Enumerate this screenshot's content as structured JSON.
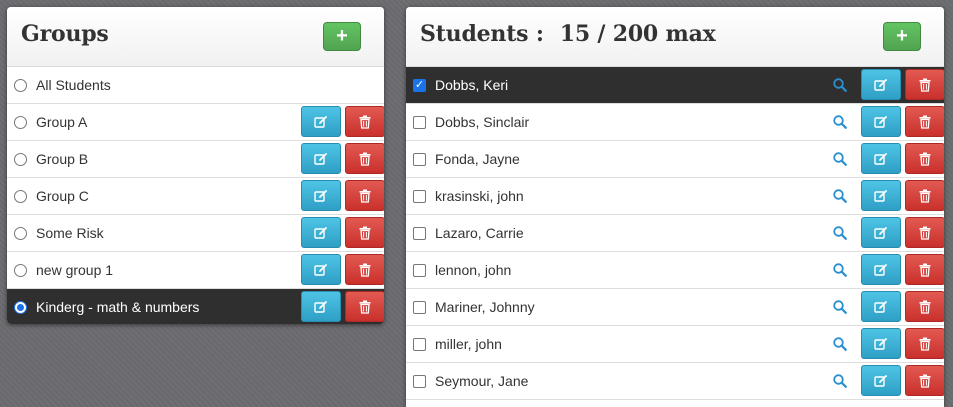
{
  "groups_panel": {
    "title": "Groups",
    "add_label": "+",
    "items": [
      {
        "label": "All Students",
        "selected": false,
        "actions": false
      },
      {
        "label": "Group A",
        "selected": false,
        "actions": true
      },
      {
        "label": "Group B",
        "selected": false,
        "actions": true
      },
      {
        "label": "Group C",
        "selected": false,
        "actions": true
      },
      {
        "label": "Some Risk",
        "selected": false,
        "actions": true
      },
      {
        "label": "new group 1",
        "selected": false,
        "actions": true
      },
      {
        "label": "Kinderg - math & numbers",
        "selected": true,
        "actions": true
      }
    ]
  },
  "students_panel": {
    "title": "Students :",
    "count": "15 / 200 max",
    "add_label": "+",
    "items": [
      {
        "label": "Dobbs, Keri",
        "checked": true
      },
      {
        "label": "Dobbs, Sinclair",
        "checked": false
      },
      {
        "label": "Fonda, Jayne",
        "checked": false
      },
      {
        "label": "krasinski, john",
        "checked": false
      },
      {
        "label": "Lazaro, Carrie",
        "checked": false
      },
      {
        "label": "lennon, john",
        "checked": false
      },
      {
        "label": "Mariner, Johnny",
        "checked": false
      },
      {
        "label": "miller, john",
        "checked": false
      },
      {
        "label": "Seymour, Jane",
        "checked": false
      }
    ]
  },
  "icons": {
    "edit": "pencil-square-icon",
    "delete": "trash-icon",
    "search": "search-icon",
    "add": "plus-icon"
  },
  "colors": {
    "add": "#5bb75b",
    "edit": "#3aafd6",
    "delete": "#d9403b",
    "selected_row": "#2f2f2f",
    "search_icon": "#2a8fd0"
  }
}
